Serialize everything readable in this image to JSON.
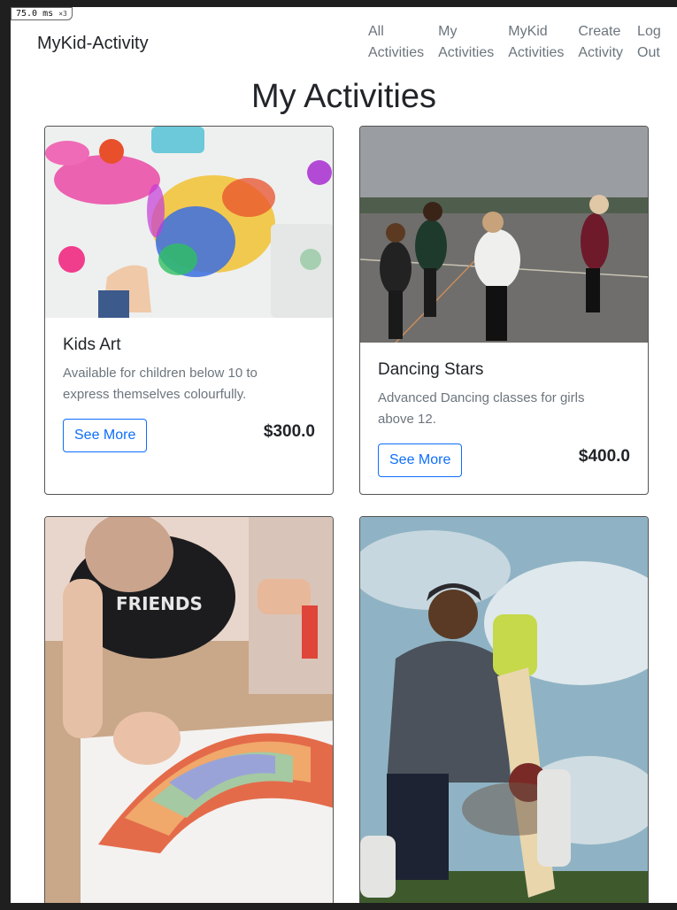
{
  "perf_badge": {
    "value": "75.0",
    "unit": "ms",
    "multiplier": "×3"
  },
  "navbar": {
    "brand": "MyKid-Activity",
    "links": [
      {
        "line1": "All",
        "line2": "Activities"
      },
      {
        "line1": "My",
        "line2": "Activities"
      },
      {
        "line1": "MyKid",
        "line2": "Activities"
      },
      {
        "line1": "Create",
        "line2": "Activity"
      },
      {
        "line1": "Log",
        "line2": "Out"
      }
    ]
  },
  "page_title": "My Activities",
  "button_label": "See More",
  "cards": [
    {
      "title": "Kids Art",
      "description": "Available for children below 10 to express themselves colourfully.",
      "price": "$300.0",
      "image": "paint-art-photo"
    },
    {
      "title": "Dancing Stars",
      "description": "Advanced Dancing classes for girls above 12.",
      "price": "$400.0",
      "image": "dancing-girls-photo"
    },
    {
      "title": "",
      "description": "",
      "price": "",
      "image": "paper-collage-photo"
    },
    {
      "title": "",
      "description": "",
      "price": "",
      "image": "cricket-batsman-photo"
    }
  ],
  "colors": {
    "primary": "#0d6efd",
    "muted": "#6c757d",
    "text": "#212529"
  }
}
